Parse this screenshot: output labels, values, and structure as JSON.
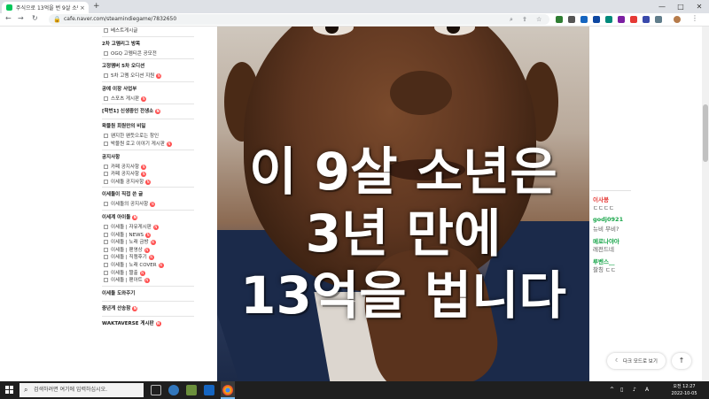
{
  "browser": {
    "tab_title": "주식으로 13억을 번 9살 소년",
    "tab_close": "×",
    "new_tab": "+",
    "url": "cafe.naver.com/steamindiegame/7832650",
    "window_controls": [
      "—",
      "□",
      "✕"
    ],
    "nav": {
      "back": "←",
      "forward": "→",
      "reload": "↻"
    }
  },
  "sidebar": {
    "rows": [
      {
        "text": "베스트게시글",
        "type": "item"
      },
      {
        "text": "2차 고멤리그 방목",
        "type": "header"
      },
      {
        "text": "OGQ 고멤티콘 공모전",
        "type": "item"
      },
      {
        "text": "고정멤버 5차 오디션",
        "type": "header"
      },
      {
        "text": "5차 고멤 오디션 지원",
        "type": "item"
      },
      {
        "text": "공예 이장 사업부",
        "type": "header"
      },
      {
        "text": "스포츠 게시판",
        "type": "item"
      },
      {
        "text": "[학번1] 신생중인 전생소",
        "type": "header"
      },
      {
        "text": "왁물원 회원만의 비밀",
        "type": "header"
      },
      {
        "text": "왠지한 왠듯으로는 창인",
        "type": "item"
      },
      {
        "text": "박물원 로고 이야기 게시판",
        "type": "item"
      },
      {
        "text": "공지사항",
        "type": "header"
      },
      {
        "text": "카페 공지사항",
        "type": "item"
      },
      {
        "text": "카페 공지사항",
        "type": "item"
      },
      {
        "text": "이세돌 공지사항",
        "type": "item"
      },
      {
        "text": "이세돌이 직접 쓴 글",
        "type": "header"
      },
      {
        "text": "이세돌의 공지사항",
        "type": "item"
      },
      {
        "text": "이세계 아이돌",
        "type": "header"
      },
      {
        "text": "이세돌 | 자유게시판",
        "type": "item"
      },
      {
        "text": "이세돌 | NEWS",
        "type": "item"
      },
      {
        "text": "이세돌 | 노래 금방",
        "type": "item"
      },
      {
        "text": "이세돌 | 팬영상",
        "type": "item"
      },
      {
        "text": "이세돌 | 직캠후기",
        "type": "item"
      },
      {
        "text": "이세돌 | 노래 COVER",
        "type": "item"
      },
      {
        "text": "이세돌 | 짤출",
        "type": "item"
      },
      {
        "text": "이세돌 | 팬아트",
        "type": "item"
      },
      {
        "text": "이세돌 도와주기",
        "type": "header"
      },
      {
        "text": "중년게 산송참",
        "type": "header"
      },
      {
        "text": "WAKTAVERSE 게시판",
        "type": "header"
      }
    ]
  },
  "video": {
    "caption_lines": [
      "이 9살 소년은",
      "3년 만에",
      "13억을 법니다"
    ]
  },
  "chat": {
    "messages": [
      {
        "user": "이사봉",
        "user_color": "#e53935",
        "text": "ㄷㄷㄷㄷ"
      },
      {
        "user": "godj0921",
        "user_color": "#1aa64b",
        "text": "뉴비 무비?"
      },
      {
        "user": "메로나야아",
        "user_color": "#1aa64b",
        "text": "레전드네"
      },
      {
        "user": "루벤스__",
        "user_color": "#1aa64b",
        "text": "찰칭 ㄷㄷ"
      }
    ],
    "dark_mode_label": "다크 모드로 보기",
    "top_button": "↑"
  },
  "taskbar": {
    "search_placeholder": "검색하려면 여기에 입력하십시오.",
    "time": "오전 12:27",
    "date": "2022-10-05",
    "lang": "A"
  },
  "colors": {
    "naver_green": "#03c75a",
    "badge_red": "#ff4e4e"
  }
}
